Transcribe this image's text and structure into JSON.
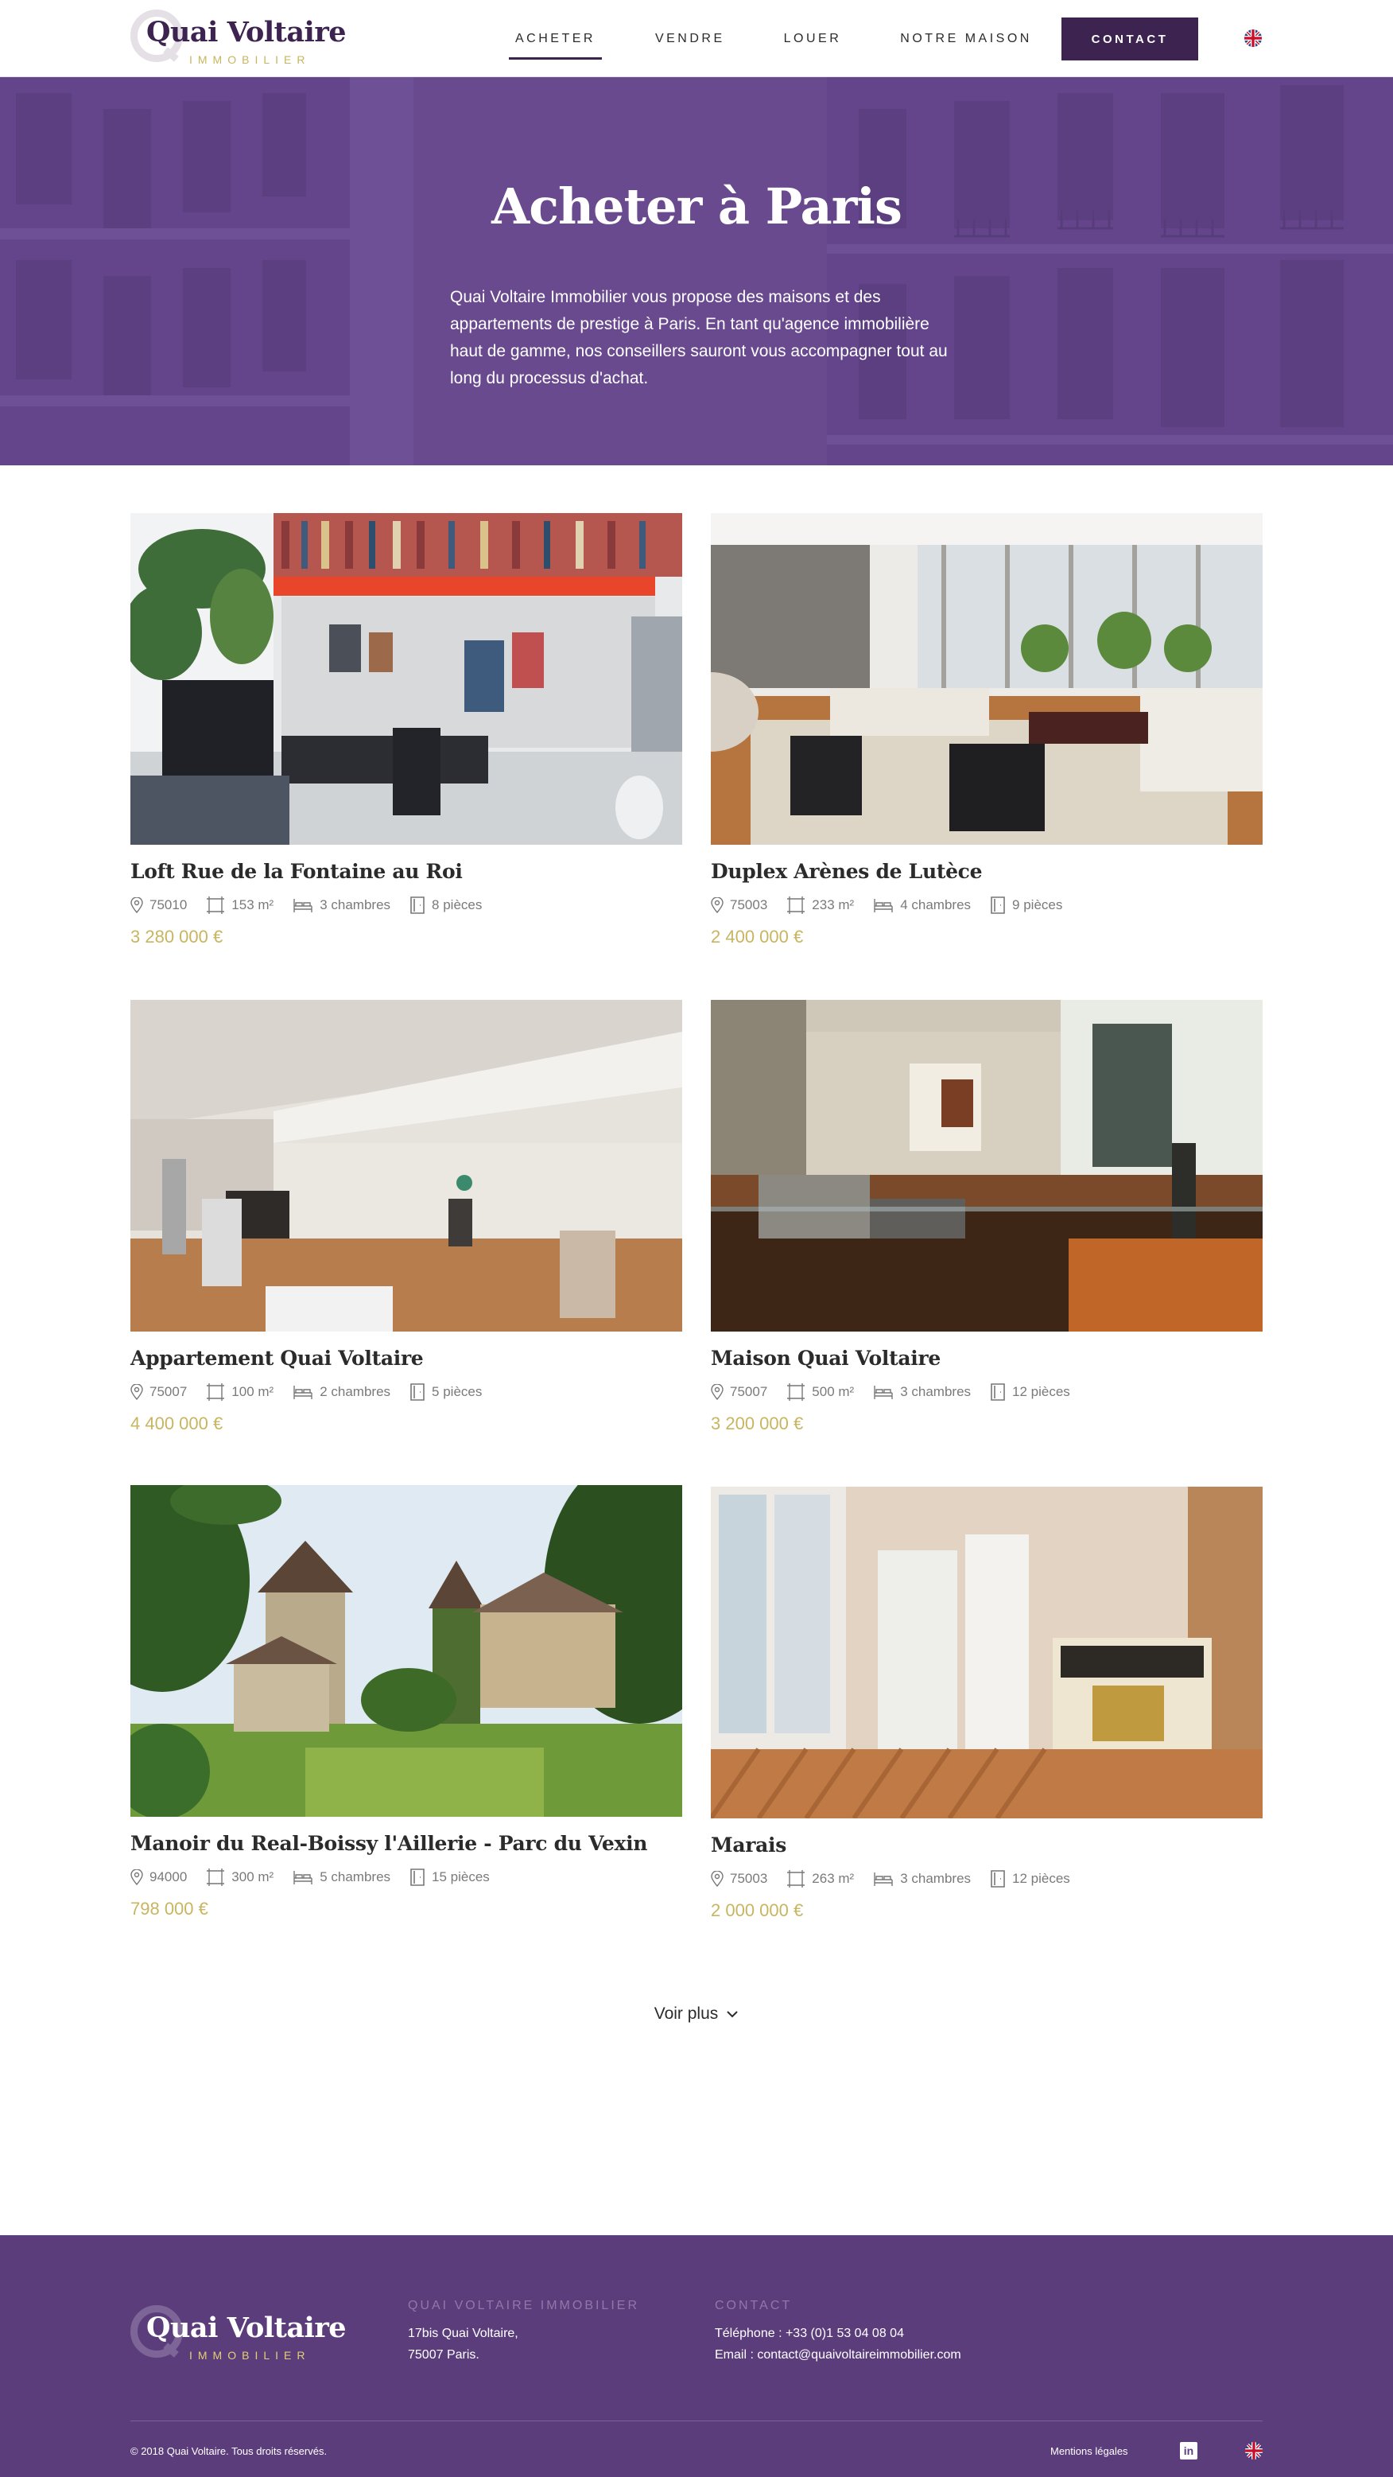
{
  "header": {
    "logo_name": "Quai Voltaire",
    "logo_sub": "IMMOBILIER",
    "nav": [
      {
        "label": "ACHETER",
        "active": true
      },
      {
        "label": "VENDRE",
        "active": false
      },
      {
        "label": "LOUER",
        "active": false
      },
      {
        "label": "NOTRE MAISON",
        "active": false
      }
    ],
    "contact_label": "CONTACT",
    "language_icon": "uk-flag-icon"
  },
  "hero": {
    "title": "Acheter à Paris",
    "text": "Quai Voltaire Immobilier vous propose des maisons et des appartements de prestige à Paris. En tant qu'agence immobilière haut de gamme, nos conseillers sauront vous accompagner tout au long du processus d'achat."
  },
  "listings": [
    {
      "title": "Loft Rue de la Fontaine au Roi",
      "zip": "75010",
      "area": "153 m²",
      "rooms": "3 chambres",
      "pieces": "8 pièces",
      "price": "3 280 000 €"
    },
    {
      "title": "Duplex Arènes de Lutèce",
      "zip": "75003",
      "area": "233 m²",
      "rooms": "4 chambres",
      "pieces": "9 pièces",
      "price": "2 400 000 €"
    },
    {
      "title": "Appartement Quai Voltaire",
      "zip": "75007",
      "area": "100 m²",
      "rooms": "2 chambres",
      "pieces": "5 pièces",
      "price": "4 400 000 €"
    },
    {
      "title": "Maison Quai Voltaire",
      "zip": "75007",
      "area": "500 m²",
      "rooms": "3 chambres",
      "pieces": "12 pièces",
      "price": "3 200 000 €"
    },
    {
      "title": "Manoir du Real-Boissy l'Aillerie - Parc du Vexin",
      "zip": "94000",
      "area": "300 m²",
      "rooms": "5 chambres",
      "pieces": "15 pièces",
      "price": "798 000 €"
    },
    {
      "title": "Marais",
      "zip": "75003",
      "area": "263 m²",
      "rooms": "3 chambres",
      "pieces": "12 pièces",
      "price": "2 000 000 €"
    }
  ],
  "voir_plus_label": "Voir plus",
  "footer": {
    "logo_name": "Quai Voltaire",
    "logo_sub": "IMMOBILIER",
    "col1_heading": "QUAI VOLTAIRE IMMOBILIER",
    "address_line1": "17bis Quai Voltaire,",
    "address_line2": "75007 Paris.",
    "col2_heading": "CONTACT",
    "phone": "Téléphone :  +33 (0)1 53 04 08 04",
    "email": "Email : contact@quaivoltaireimmobilier.com",
    "copyright": "© 2018 Quai Voltaire. Tous droits réservés.",
    "legal_label": "Mentions légales",
    "linkedin_glyph": "in",
    "language_icon": "uk-flag-icon"
  },
  "colors": {
    "brand_purple": "#3d2350",
    "hero_purple": "#6a4a8e",
    "footer_purple": "#5c3d7c",
    "gold": "#c8b560"
  }
}
